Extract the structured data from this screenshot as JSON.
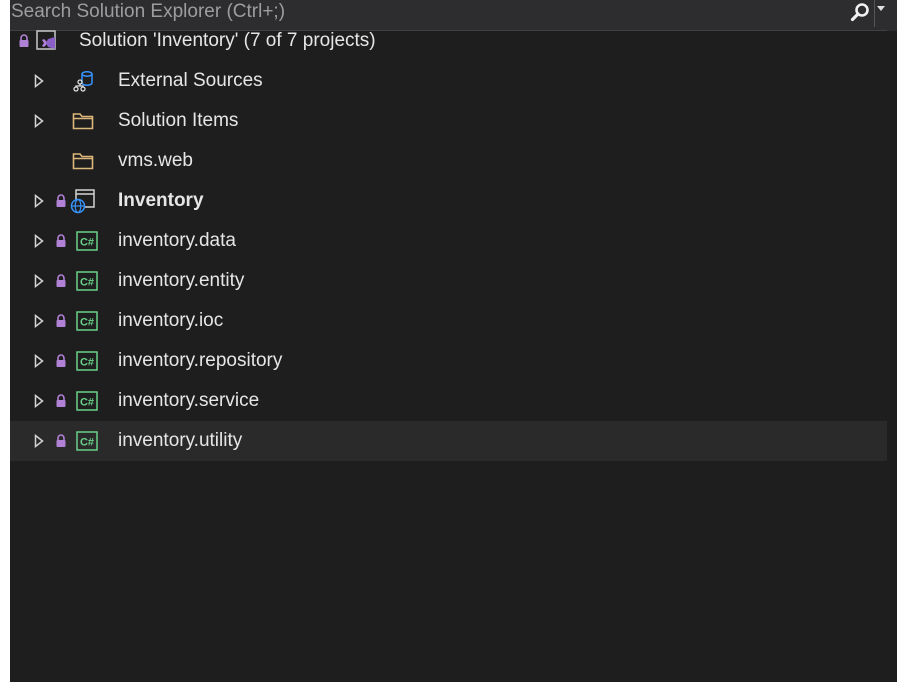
{
  "search": {
    "placeholder": "Search Solution Explorer (Ctrl+;)",
    "search_icon": "search-icon",
    "dropdown_icon": "chevron-down-icon"
  },
  "tree": {
    "solution": {
      "label": "Solution 'Inventory' (7 of 7 projects)",
      "icon": "solution-icon",
      "locked": true
    },
    "items": [
      {
        "label": "External Sources",
        "icon": "external-sources-icon",
        "expandable": true,
        "locked": false,
        "bold": false
      },
      {
        "label": "Solution Items",
        "icon": "folder-icon",
        "expandable": true,
        "locked": false,
        "bold": false
      },
      {
        "label": "vms.web",
        "icon": "folder-icon",
        "expandable": false,
        "locked": false,
        "bold": false
      },
      {
        "label": "Inventory",
        "icon": "web-project-icon",
        "expandable": true,
        "locked": true,
        "bold": true
      },
      {
        "label": "inventory.data",
        "icon": "csharp-project-icon",
        "expandable": true,
        "locked": true,
        "bold": false
      },
      {
        "label": "inventory.entity",
        "icon": "csharp-project-icon",
        "expandable": true,
        "locked": true,
        "bold": false
      },
      {
        "label": "inventory.ioc",
        "icon": "csharp-project-icon",
        "expandable": true,
        "locked": true,
        "bold": false
      },
      {
        "label": "inventory.repository",
        "icon": "csharp-project-icon",
        "expandable": true,
        "locked": true,
        "bold": false
      },
      {
        "label": "inventory.service",
        "icon": "csharp-project-icon",
        "expandable": true,
        "locked": true,
        "bold": false
      },
      {
        "label": "inventory.utility",
        "icon": "csharp-project-icon",
        "expandable": true,
        "locked": true,
        "bold": false
      }
    ]
  },
  "colors": {
    "background": "#1e1e1e",
    "text": "#e6e6e6",
    "folder": "#dcb67a",
    "csharp": "#6bd089",
    "vs_purple": "#b180d7",
    "web_blue": "#3794ff",
    "hover_row": "#2a2a2a"
  }
}
